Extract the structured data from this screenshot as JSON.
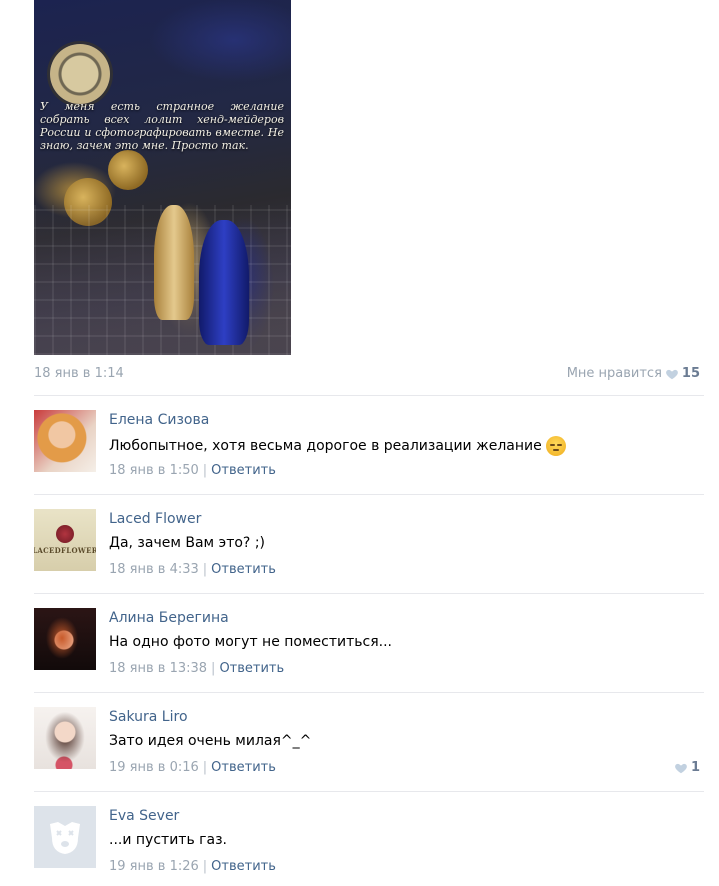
{
  "post": {
    "image_caption": "У меня есть странное желание собрать всех лолит хенд-мейдеров России и сфотографировать вместе. Не знаю, зачем это мне. Просто так.",
    "date": "18 янв в 1:14",
    "like_label": "Мне нравится",
    "like_count": "15"
  },
  "reply_label": "Ответить",
  "separator": "|",
  "comments": [
    {
      "author": "Елена Сизова",
      "text": "Любопытное, хотя весьма дорогое в реализации желание",
      "emoji": "pensive-face",
      "time": "18 янв в 1:50",
      "likes": ""
    },
    {
      "author": "Laced Flower",
      "text": "Да, зачем Вам это? ;)",
      "avatar_text": "LACEDFLOWER",
      "time": "18 янв в 4:33",
      "likes": ""
    },
    {
      "author": "Алина Берегина",
      "text": "На одно фото могут не поместиться...",
      "time": "18 янв в 13:38",
      "likes": ""
    },
    {
      "author": "Sakura Liro",
      "text": "Зато идея очень милая^_^",
      "time": "19 янв в 0:16",
      "likes": "1"
    },
    {
      "author": "Eva Sever",
      "text": "...и пустить газ.",
      "time": "19 янв в 1:26",
      "likes": ""
    }
  ],
  "colors": {
    "link": "#42648b",
    "meta": "#9aa5b1",
    "like_heart": "#c2d1e0",
    "divider": "#e7e8ec"
  }
}
